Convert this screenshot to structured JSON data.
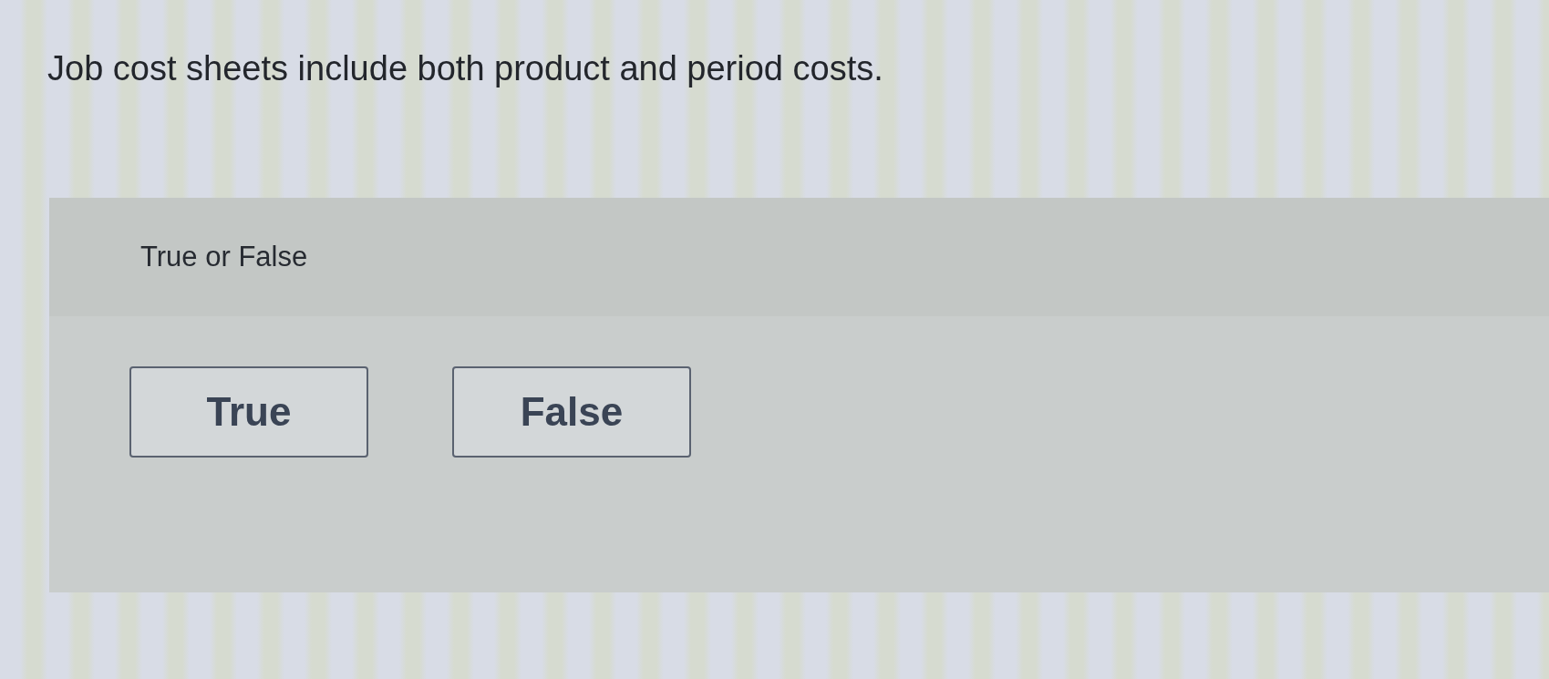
{
  "question": {
    "text": "Job cost sheets include both product and period costs."
  },
  "answer_panel": {
    "prompt": "True or False",
    "options": [
      {
        "label": "True",
        "selected": false
      },
      {
        "label": "False",
        "selected": false
      }
    ]
  }
}
